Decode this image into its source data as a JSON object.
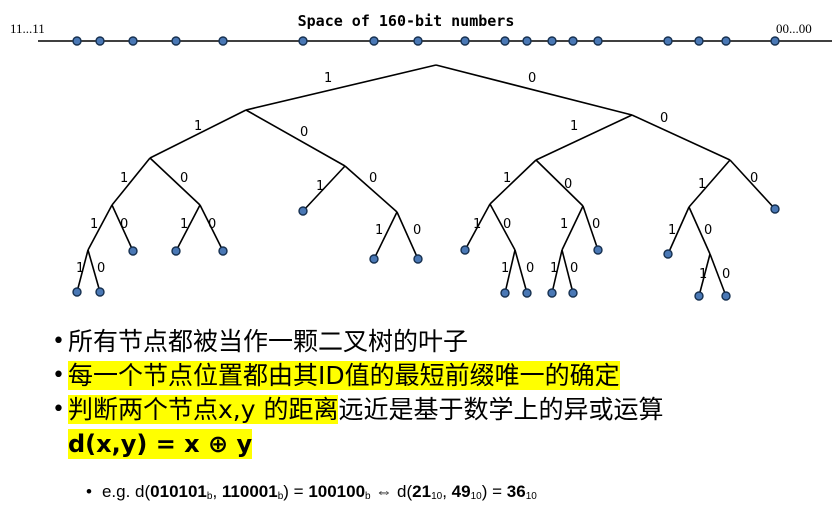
{
  "id_space": {
    "title": "Space of 160-bit numbers",
    "left_end": "11...11",
    "right_end": "00...00"
  },
  "tree": {
    "edge_label_one": "1",
    "edge_label_zero": "0"
  },
  "bullets": {
    "b1": "所有节点都被当作一颗二叉树的叶子",
    "b2": "每一个节点位置都由其ID值的最短前缀唯一的确定",
    "b3_part1": "判断两个节点x,y 的距离",
    "b3_part2": "远近是基于数学上的异或运算",
    "formula": "d(x,y) = x ⊕ y"
  },
  "example": {
    "prefix": "e.g. d(",
    "a": "010101",
    "a_sub": "b",
    "comma1": ", ",
    "b": "110001",
    "b_sub": "b",
    "eq1": ") = ",
    "r": "100100",
    "r_sub": "b",
    "iff": " ⇔ d(",
    "a10": "21",
    "a10_sub": "10",
    "comma2": ", ",
    "b10": "49",
    "b10_sub": "10",
    "eq2": ") = ",
    "r10": "36",
    "r10_sub": "10"
  },
  "colors": {
    "node": "#4a78b5",
    "highlight": "#ffff00"
  }
}
